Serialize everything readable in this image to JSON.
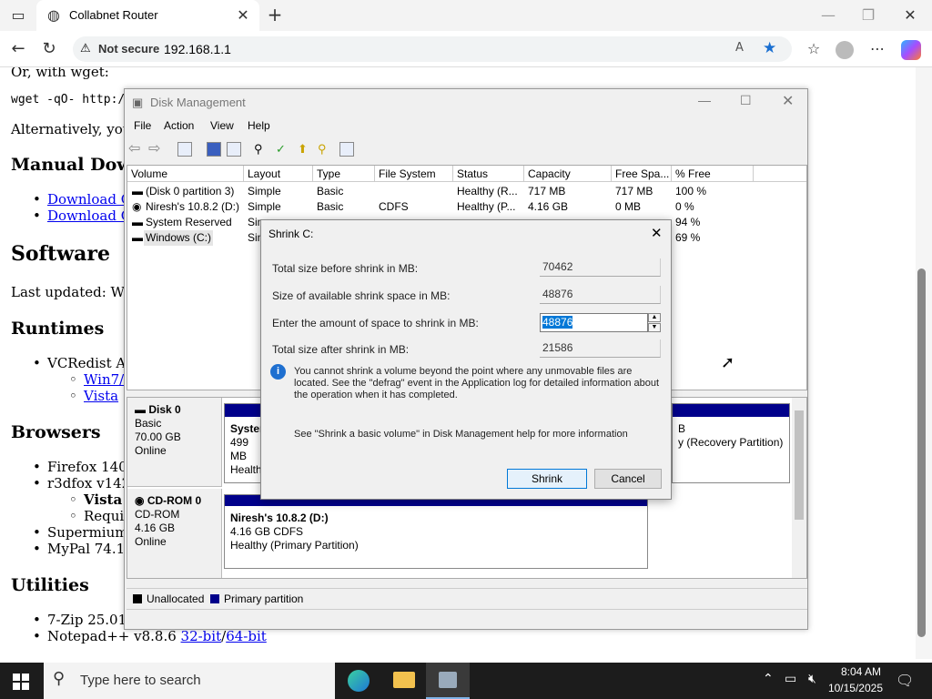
{
  "browser": {
    "tab_title": "Collabnet Router",
    "not_secure": "Not secure",
    "url": "192.168.1.1"
  },
  "page": {
    "line_wget_intro": "Or, with wget:",
    "line_wget_cmd": "wget -qO- http://c",
    "line_alt": "Alternatively, you c",
    "h_manual": "Manual Downlo",
    "link_download1": "Download Co",
    "link_download2": "Download Co",
    "h_software": "Software",
    "line_updated": "Last updated: Wed,",
    "h_runtimes": "Runtimes",
    "li_vcredist": "VCRedist Al",
    "sub_win7": "Win7/V",
    "sub_vista": "Vista",
    "h_browsers": "Browsers",
    "li_firefox": "Firefox 140.4",
    "li_r3dfox": "r3dfox v142.",
    "sub_vista2": "Vista c",
    "sub_requir": "Requir",
    "li_supermium": "Supermium v",
    "li_mypal": "MyPal 74.1.1",
    "h_utilities": "Utilities",
    "li_7zip": "7-Zip 25.01 3",
    "li_notepad": "Notepad++ v8.8.6 ",
    "link_32": "32-bit",
    "slash": "/",
    "link_64": "64-bit"
  },
  "diskmgmt": {
    "title": "Disk Management",
    "menu": [
      "File",
      "Action",
      "View",
      "Help"
    ],
    "columns": [
      "Volume",
      "Layout",
      "Type",
      "File System",
      "Status",
      "Capacity",
      "Free Spa...",
      "% Free"
    ],
    "rows": [
      [
        "(Disk 0 partition 3)",
        "Simple",
        "Basic",
        "",
        "Healthy (R...",
        "717 MB",
        "717 MB",
        "100 %"
      ],
      [
        "Niresh's 10.8.2 (D:)",
        "Simple",
        "Basic",
        "CDFS",
        "Healthy (P...",
        "4.16 GB",
        "0 MB",
        "0 %"
      ],
      [
        "System Reserved",
        "Sim",
        "",
        "",
        "",
        "",
        "",
        "94 %"
      ],
      [
        "Windows (C:)",
        "Sin",
        "",
        "",
        "",
        "",
        "",
        "69 %"
      ]
    ],
    "disk0": {
      "name": "Disk 0",
      "type": "Basic",
      "size": "70.00 GB",
      "state": "Online",
      "part1_name": "System",
      "part1_size": "499 MB",
      "part1_state": "Healthy",
      "part3_size": "B",
      "part3_state": "y (Recovery Partition)"
    },
    "cdrom": {
      "name": "CD-ROM 0",
      "type": "CD-ROM",
      "size": "4.16 GB",
      "state": "Online",
      "part_name": "Niresh's 10.8.2  (D:)",
      "part_size": "4.16 GB CDFS",
      "part_state": "Healthy (Primary Partition)"
    },
    "legend_unallocated": "Unallocated",
    "legend_primary": "Primary partition"
  },
  "shrink": {
    "title": "Shrink C:",
    "label_total_before": "Total size before shrink in MB:",
    "value_total_before": "70462",
    "label_available": "Size of available shrink space in MB:",
    "value_available": "48876",
    "label_amount": "Enter the amount of space to shrink in MB:",
    "value_amount": "48876",
    "label_total_after": "Total size after shrink in MB:",
    "value_total_after": "21586",
    "info_text": "You cannot shrink a volume beyond the point where any unmovable files are located. See the \"defrag\" event in the Application log for detailed information about the operation when it has completed.",
    "help_text": "See \"Shrink a basic volume\" in Disk Management help for more information",
    "shrink_button": "Shrink",
    "cancel_button": "Cancel"
  },
  "taskbar": {
    "search_placeholder": "Type here to search",
    "time": "8:04 AM",
    "date": "10/15/2025"
  },
  "colors": {
    "accent": "#0078d7",
    "primary_partition": "#00008b",
    "link": "#0000ee"
  }
}
